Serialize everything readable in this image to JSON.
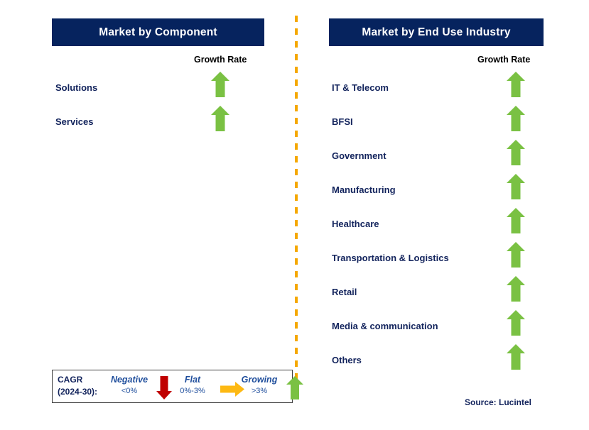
{
  "colors": {
    "header_bg": "#06235e",
    "header_text": "#ffffff",
    "label_navy": "#12235c",
    "arrow_green": "#7ac143",
    "arrow_red": "#c00000",
    "arrow_orange": "#fdb913",
    "divider_orange": "#f5a800",
    "legend_blue": "#1f4e9c"
  },
  "panels": [
    {
      "id": "component",
      "title": "Market by Component",
      "growth_caption": "Growth Rate",
      "items": [
        {
          "label": "Solutions",
          "growth": "growing",
          "icon": "up-arrow-icon"
        },
        {
          "label": "Services",
          "growth": "growing",
          "icon": "up-arrow-icon"
        }
      ]
    },
    {
      "id": "end-use-industry",
      "title": "Market by End Use Industry",
      "growth_caption": "Growth Rate",
      "items": [
        {
          "label": "IT & Telecom",
          "growth": "growing",
          "icon": "up-arrow-icon"
        },
        {
          "label": "BFSI",
          "growth": "growing",
          "icon": "up-arrow-icon"
        },
        {
          "label": "Government",
          "growth": "growing",
          "icon": "up-arrow-icon"
        },
        {
          "label": "Manufacturing",
          "growth": "growing",
          "icon": "up-arrow-icon"
        },
        {
          "label": "Healthcare",
          "growth": "growing",
          "icon": "up-arrow-icon"
        },
        {
          "label": "Transportation & Logistics",
          "growth": "growing",
          "icon": "up-arrow-icon"
        },
        {
          "label": "Retail",
          "growth": "growing",
          "icon": "up-arrow-icon"
        },
        {
          "label": "Media & communication",
          "growth": "growing",
          "icon": "up-arrow-icon"
        },
        {
          "label": "Others",
          "growth": "growing",
          "icon": "up-arrow-icon"
        }
      ]
    }
  ],
  "legend": {
    "cagr_line1": "CAGR",
    "cagr_line2": "(2024-30):",
    "entries": [
      {
        "title": "Negative",
        "range": "<0%",
        "icon": "down-arrow-icon",
        "color": "#c00000"
      },
      {
        "title": "Flat",
        "range": "0%-3%",
        "icon": "right-arrow-icon",
        "color": "#fdb913"
      },
      {
        "title": "Growing",
        "range": ">3%",
        "icon": "up-arrow-icon",
        "color": "#7ac143"
      }
    ]
  },
  "source": "Source: Lucintel"
}
